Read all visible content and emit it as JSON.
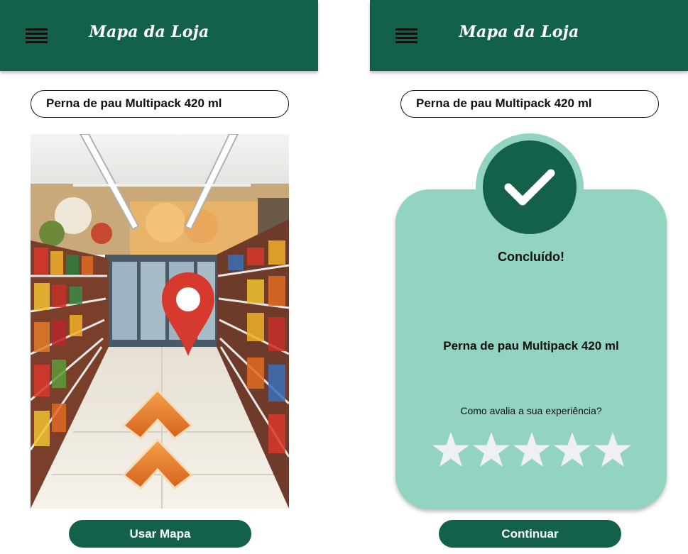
{
  "colors": {
    "brand_green": "#14614b",
    "mint": "#93d3c2",
    "star": "#eef0f6",
    "pin_red": "#d63a2f",
    "arrow_orange": "#e97f2a"
  },
  "left_screen": {
    "header": {
      "title": "Mapa da Loja",
      "menu_icon": "hamburger-menu-icon"
    },
    "product_field": {
      "value": "Perna de pau Multipack 420 ml"
    },
    "action_button": {
      "label": "Usar Mapa"
    }
  },
  "right_screen": {
    "header": {
      "title": "Mapa da Loja",
      "menu_icon": "hamburger-menu-icon"
    },
    "product_field": {
      "value": "Perna de pau Multipack 420 ml"
    },
    "card": {
      "status": "Concluído!",
      "product": "Perna de pau Multipack 420 ml",
      "rating_prompt": "Como avalia a sua experiência?",
      "rating_max": 5
    },
    "action_button": {
      "label": "Continuar"
    }
  }
}
